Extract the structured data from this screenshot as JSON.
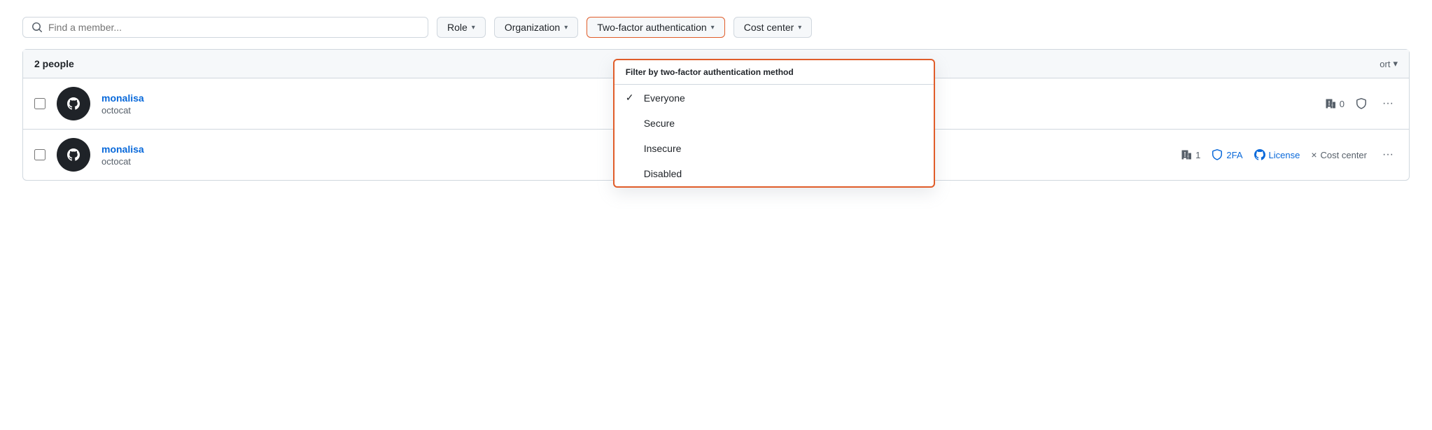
{
  "toolbar": {
    "search_placeholder": "Find a member...",
    "role_label": "Role",
    "organization_label": "Organization",
    "two_factor_label": "Two-factor authentication",
    "cost_center_label": "Cost center"
  },
  "table": {
    "people_count": "2 people",
    "sort_label": "ort"
  },
  "members": [
    {
      "name": "monalisa",
      "org": "octocat",
      "orgs_count": "0",
      "badges": [],
      "has_more": true
    },
    {
      "name": "monalisa",
      "org": "octocat",
      "orgs_count": "1",
      "badges": [
        "2FA",
        "License",
        "Cost center"
      ],
      "has_more": true
    }
  ],
  "tfa_dropdown": {
    "header": "Filter by two-factor authentication method",
    "items": [
      {
        "label": "Everyone",
        "selected": true
      },
      {
        "label": "Secure",
        "selected": false
      },
      {
        "label": "Insecure",
        "selected": false
      },
      {
        "label": "Disabled",
        "selected": false
      }
    ]
  },
  "icons": {
    "search": "🔍",
    "chevron_down": "▾",
    "checkmark": "✓",
    "more": "···",
    "buildings": "⊞",
    "shield": "⊙",
    "github_mark": "●",
    "cross": "×"
  }
}
